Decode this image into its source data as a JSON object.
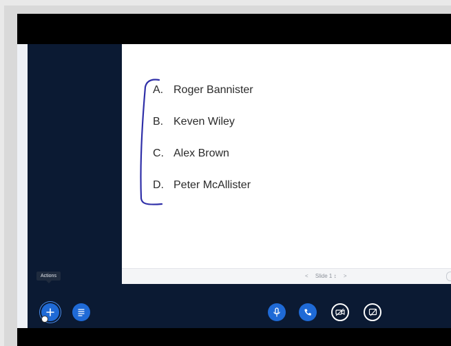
{
  "slide": {
    "answers": [
      {
        "letter": "A.",
        "text": "Roger Bannister"
      },
      {
        "letter": "B.",
        "text": "Keven Wiley"
      },
      {
        "letter": "C.",
        "text": "Alex Brown"
      },
      {
        "letter": "D.",
        "text": "Peter McAllister"
      }
    ]
  },
  "slide_nav": {
    "prev": "<",
    "label": "Slide 1",
    "next": ">"
  },
  "toolbar": {
    "actions_tooltip": "Actions"
  },
  "icons": {
    "actions": "plus-icon",
    "notes": "document-lines-icon",
    "microphone": "microphone-icon",
    "phone": "phone-icon",
    "webcam": "webcam-icon",
    "screen_share": "screen-share-icon"
  },
  "colors": {
    "accent": "#1f6ad6",
    "app_background": "#0b1a33",
    "bracket": "#2f2fa8"
  }
}
